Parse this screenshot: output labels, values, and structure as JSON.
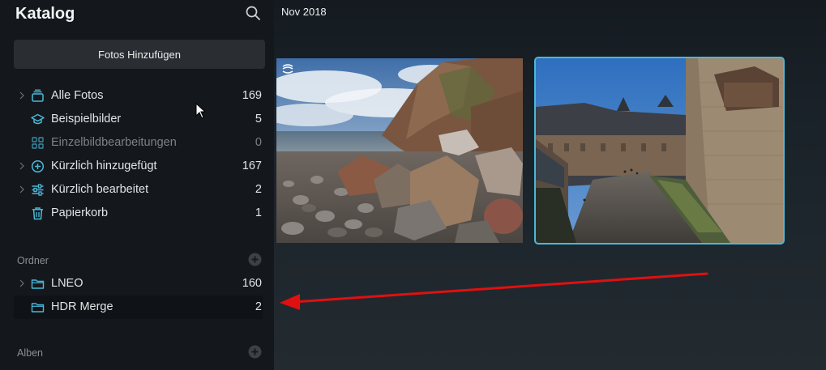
{
  "sidebar": {
    "title": "Katalog",
    "add_photos_label": "Fotos Hinzufügen",
    "items": [
      {
        "label": "Alle Fotos",
        "count": "169",
        "icon": "stack-icon"
      },
      {
        "label": "Beispielbilder",
        "count": "5",
        "icon": "graduation-cap-icon"
      },
      {
        "label": "Einzelbildbearbeitungen",
        "count": "0",
        "icon": "grid-icon"
      },
      {
        "label": "Kürzlich hinzugefügt",
        "count": "167",
        "icon": "plus-circle-icon"
      },
      {
        "label": "Kürzlich bearbeitet",
        "count": "2",
        "icon": "sliders-icon"
      },
      {
        "label": "Papierkorb",
        "count": "1",
        "icon": "trash-icon"
      }
    ],
    "folders_header": "Ordner",
    "folders": [
      {
        "label": "LNEO",
        "count": "160",
        "icon": "folder-icon"
      },
      {
        "label": "HDR Merge",
        "count": "2",
        "icon": "folder-icon"
      }
    ],
    "albums_header": "Alben"
  },
  "main": {
    "date_header": "Nov 2018",
    "photos": [
      {
        "name": "coastal-rocks-photo"
      },
      {
        "name": "castle-courtyard-photo"
      }
    ]
  },
  "colors": {
    "accent": "#49b9d8",
    "annotation_arrow": "#e01010"
  }
}
